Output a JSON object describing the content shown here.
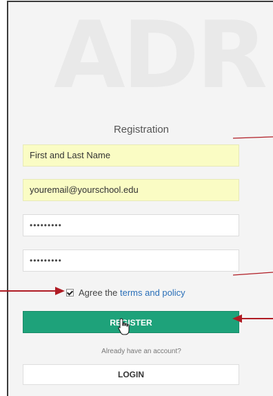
{
  "watermark": "ADR",
  "form": {
    "title": "Registration",
    "name_value": "First and Last Name",
    "email_value": "youremail@yourschool.edu",
    "password_value": "•••••••••",
    "confirm_password_value": "•••••••••",
    "agree_text": "Agree the ",
    "terms_link": "terms and policy",
    "agree_checked": true,
    "register_label": "REGISTER",
    "already_text": "Already have an account?",
    "login_label": "LOGIN"
  },
  "colors": {
    "panel_bg": "#f4f4f4",
    "autofill_bg": "#fafcc4",
    "primary": "#1ea27a",
    "link": "#2a6fb8",
    "annotation_arrow": "#b01c24"
  },
  "icons": {
    "cursor": "hand-pointer-icon",
    "annotation": "red-arrow-icon"
  }
}
